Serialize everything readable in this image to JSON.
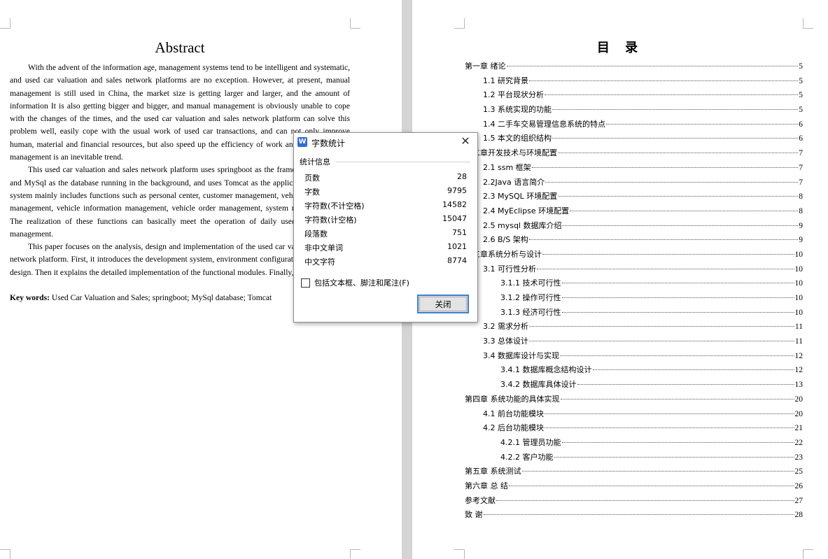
{
  "abstract": {
    "title": "Abstract",
    "paragraphs": [
      "With the advent of the information age, management systems tend to be intelligent and systematic, and used car valuation and sales network platforms are no exception. However, at present, manual management is still used in China, the market size is getting larger and larger, and the amount of information It is also getting bigger and bigger, and manual management is obviously unable to cope with the changes of the times, and the used car valuation and sales network platform can solve this problem well, easily cope with the usual work of used car transactions, and can not only improve human, material and financial resources, but also speed up the efficiency of work and replace manual management is an inevitable trend.",
      "This used car valuation and sales network platform uses springboot as the framework, B/S mode and MySql as the database running in the background, and uses Tomcat as the application server. This system mainly includes functions such as personal center, customer management, vehicle classification management, vehicle information management, vehicle order management, system management, etc. The realization of these functions can basically meet the operation of daily used car transaction management.",
      "This paper focuses on the analysis, design and implementation of the used car valuation and sales network platform. First, it introduces the development system, environment configuration, and database design. Then it explains the detailed implementation of the functional modules. Finally, it summarizes."
    ],
    "keywords_label": "Key words:",
    "keywords": " Used Car Valuation and Sales; springboot; MySql database; Tomcat"
  },
  "toc": {
    "title": "目 录",
    "entries": [
      {
        "label": "第一章  绪论",
        "page": "5",
        "level": 1
      },
      {
        "label": "1.1 研究背景",
        "page": "5",
        "level": 2
      },
      {
        "label": "1.2 平台现状分析",
        "page": "5",
        "level": 2
      },
      {
        "label": "1.3 系统实现的功能",
        "page": "5",
        "level": 2
      },
      {
        "label": "1.4 二手车交易管理信息系统的特点",
        "page": "6",
        "level": 2
      },
      {
        "label": "1.5 本文的组织结构",
        "page": "6",
        "level": 2
      },
      {
        "label": "第二章开发技术与环境配置",
        "page": "7",
        "level": 1
      },
      {
        "label": "2.1 ssm 框架",
        "page": "7",
        "level": 2
      },
      {
        "label": "2.2Java 语言简介",
        "page": "7",
        "level": 2
      },
      {
        "label": "2.3 MySQL 环境配置",
        "page": "8",
        "level": 2
      },
      {
        "label": "2.4 MyEclipse 环境配置",
        "page": "8",
        "level": 2
      },
      {
        "label": "2.5 mysql 数据库介绍",
        "page": "9",
        "level": 2
      },
      {
        "label": "2.6 B/S 架构",
        "page": "9",
        "level": 2
      },
      {
        "label": "第三章系统分析与设计",
        "page": "10",
        "level": 1
      },
      {
        "label": "3.1 可行性分析",
        "page": "10",
        "level": 2
      },
      {
        "label": "3.1.1 技术可行性",
        "page": "10",
        "level": 3
      },
      {
        "label": "3.1.2 操作可行性",
        "page": "10",
        "level": 3
      },
      {
        "label": "3.1.3 经济可行性",
        "page": "10",
        "level": 3
      },
      {
        "label": "3.2 需求分析",
        "page": "11",
        "level": 2
      },
      {
        "label": "3.3 总体设计",
        "page": "11",
        "level": 2
      },
      {
        "label": "3.4 数据库设计与实现",
        "page": "12",
        "level": 2
      },
      {
        "label": "3.4.1 数据库概念结构设计",
        "page": "12",
        "level": 3
      },
      {
        "label": "3.4.2 数据库具体设计",
        "page": "13",
        "level": 3
      },
      {
        "label": "第四章   系统功能的具体实现",
        "page": "20",
        "level": 1
      },
      {
        "label": "4.1 前台功能模块",
        "page": "20",
        "level": 2
      },
      {
        "label": "4.2 后台功能模块",
        "page": "21",
        "level": 2
      },
      {
        "label": "4.2.1 管理员功能",
        "page": "22",
        "level": 3
      },
      {
        "label": "4.2.2 客户功能",
        "page": "23",
        "level": 3
      },
      {
        "label": "第五章  系统测试",
        "page": "25",
        "level": 1
      },
      {
        "label": "第六章  总  结",
        "page": "26",
        "level": 1
      },
      {
        "label": "参考文献",
        "page": "27",
        "level": 1
      },
      {
        "label": "致  谢",
        "page": "28",
        "level": 1
      }
    ]
  },
  "dialog": {
    "app_icon": "W",
    "title": "字数统计",
    "close_glyph": "✕",
    "group_title": "统计信息",
    "stats": [
      {
        "label": "页数",
        "value": "28"
      },
      {
        "label": "字数",
        "value": "9795"
      },
      {
        "label": "字符数(不计空格)",
        "value": "14582"
      },
      {
        "label": "字符数(计空格)",
        "value": "15047"
      },
      {
        "label": "段落数",
        "value": "751"
      },
      {
        "label": "非中文单词",
        "value": "1021"
      },
      {
        "label": "中文字符",
        "value": "8774"
      }
    ],
    "checkbox_label": "包括文本框、脚注和尾注(F)",
    "checkbox_checked": false,
    "close_button": "关闭",
    "accent_color": "#3c7fd2"
  }
}
